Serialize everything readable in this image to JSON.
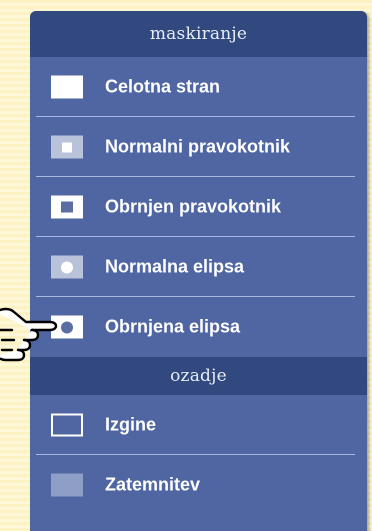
{
  "sections": [
    {
      "title": "maskiranje",
      "items": [
        {
          "label": "Celotna stran",
          "icon": "full-page-icon"
        },
        {
          "label": "Normalni pravokotnik",
          "icon": "normal-rectangle-icon"
        },
        {
          "label": "Obrnjen pravokotnik",
          "icon": "inverted-rectangle-icon"
        },
        {
          "label": "Normalna elipsa",
          "icon": "normal-ellipse-icon"
        },
        {
          "label": "Obrnjena elipsa",
          "icon": "inverted-ellipse-icon"
        }
      ]
    },
    {
      "title": "ozadje",
      "items": [
        {
          "label": "Izgine",
          "icon": "disappear-icon"
        },
        {
          "label": "Zatemnitev",
          "icon": "dim-icon"
        }
      ]
    }
  ],
  "pointer": {
    "icon": "pointing-hand-icon"
  },
  "colors": {
    "panel": "#4f66a3",
    "header": "#32497f",
    "separator": "#aab8dd",
    "page_background": "#fdf2c3"
  }
}
